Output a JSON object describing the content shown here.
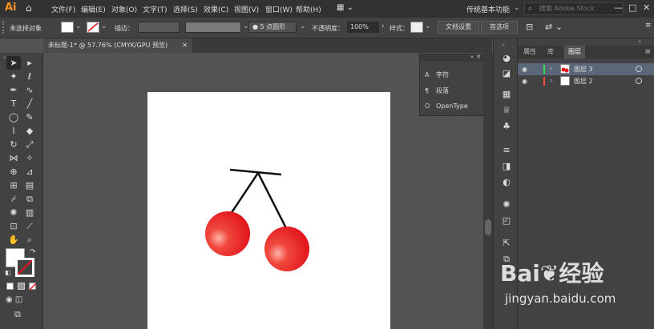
{
  "app": {
    "logo": "Ai"
  },
  "menu": [
    "文件(F)",
    "编辑(E)",
    "对象(O)",
    "文字(T)",
    "选择(S)",
    "效果(C)",
    "视图(V)",
    "窗口(W)",
    "帮助(H)"
  ],
  "workspace": {
    "label": "传统基本功能",
    "stock_placeholder": "搜索 Adobe Stock"
  },
  "control": {
    "selection_status": "未选择对象",
    "stroke_label": "描边：",
    "brush_label": "5 点圆形",
    "opacity_label": "不透明度：",
    "opacity_value": "100%",
    "style_label": "样式：",
    "doc_setup": "文档设置",
    "preferences": "首选项"
  },
  "document": {
    "tab_title": "未标题-1* @ 57.76% (CMYK/GPU 预览)"
  },
  "float_panel": {
    "items": [
      {
        "icon": "A",
        "label": "字符"
      },
      {
        "icon": "¶",
        "label": "段落"
      },
      {
        "icon": "O",
        "label": "OpenType"
      }
    ]
  },
  "layers_panel": {
    "tabs": [
      "属性",
      "库",
      "图层"
    ],
    "layers": [
      {
        "name": "图层 3",
        "color": "#3ddc4a",
        "selected": true
      },
      {
        "name": "图层 2",
        "color": "#ff4a4a",
        "selected": false
      }
    ]
  },
  "watermark": {
    "brand": "Bai",
    "brand2": "经验",
    "url": "jingyan.baidu.com"
  },
  "colors": {
    "cherry": "#e8141c",
    "artboard": "#ffffff",
    "selection": "#596779"
  }
}
